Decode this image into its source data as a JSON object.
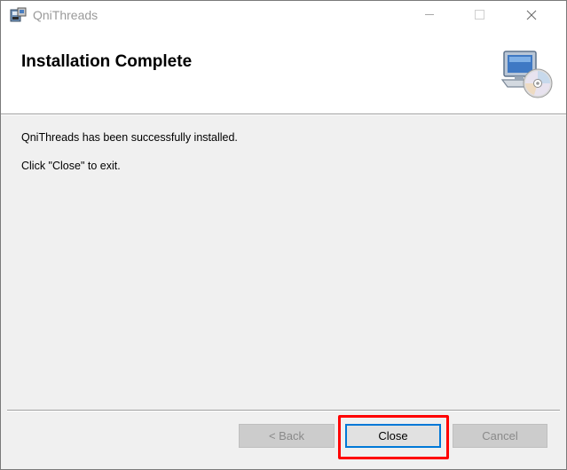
{
  "window": {
    "title": "QniThreads",
    "controls": {
      "minimize_icon": "minimize-icon",
      "maximize_icon": "maximize-icon",
      "close_icon": "close-icon"
    }
  },
  "banner": {
    "title": "Installation Complete",
    "graphic_icon": "computer-cd-icon"
  },
  "body": {
    "message_1": "QniThreads has been successfully installed.",
    "message_2": "Click \"Close\" to exit."
  },
  "footer": {
    "back_label": "< Back",
    "close_label": "Close",
    "cancel_label": "Cancel"
  },
  "colors": {
    "accent": "#0078d7",
    "highlight": "#ff0000",
    "face": "#f0f0f0"
  }
}
